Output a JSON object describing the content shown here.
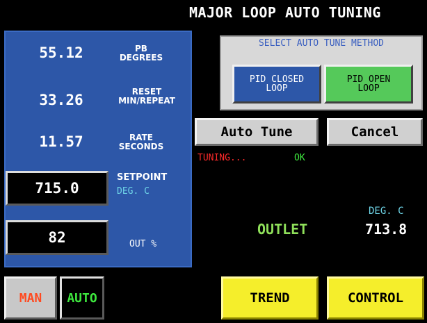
{
  "title": "MAJOR LOOP AUTO TUNING",
  "params": {
    "pb": {
      "value": "55.12",
      "label_1": "PB",
      "label_2": "DEGREES"
    },
    "reset": {
      "value": "33.26",
      "label_1": "RESET",
      "label_2": "MIN/REPEAT"
    },
    "rate": {
      "value": "11.57",
      "label_1": "RATE",
      "label_2": "SECONDS"
    }
  },
  "setpoint": {
    "value": "715.0",
    "label": "SETPOINT",
    "unit": "DEG. C"
  },
  "out": {
    "value": "82",
    "label": "OUT %"
  },
  "method": {
    "title": "SELECT AUTO TUNE METHOD",
    "closed_1": "PID CLOSED",
    "closed_2": "LOOP",
    "open_1": "PID OPEN",
    "open_2": "LOOP"
  },
  "actions": {
    "auto_tune": "Auto Tune",
    "cancel": "Cancel"
  },
  "status": {
    "tuning": "TUNING...",
    "ok": "OK"
  },
  "outlet": {
    "label": "OUTLET",
    "unit": "DEG. C",
    "value": "713.8"
  },
  "modes": {
    "man": "MAN",
    "auto": "AUTO"
  },
  "nav": {
    "trend": "TREND",
    "control": "CONTROL"
  },
  "colors": {
    "panel_blue": "#2d57a8",
    "closed_loop_btn": "#2d57a8",
    "open_loop_btn": "#55c95a",
    "status_red": "#ff2a2a",
    "status_green": "#3ee83e",
    "outlet_green": "#8fe05a",
    "unit_cyan": "#6fd6e8",
    "yellow": "#f5ee2b"
  }
}
